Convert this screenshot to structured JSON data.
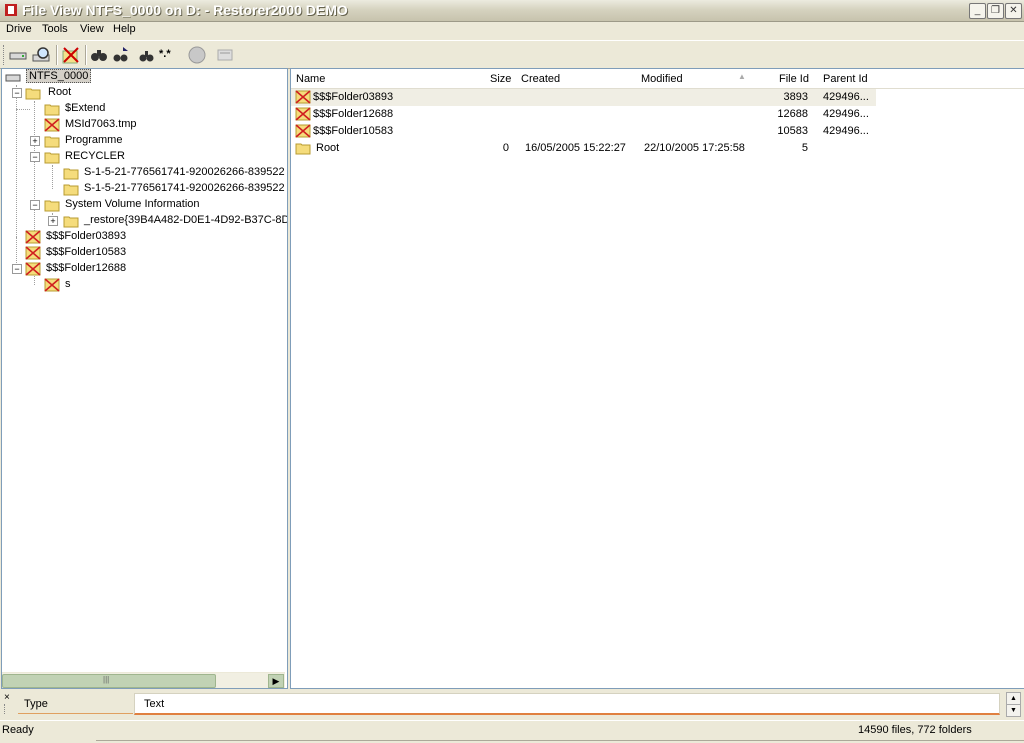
{
  "window": {
    "title": "File View NTFS_0000 on D: - Restorer2000 DEMO",
    "minimize": "_",
    "restore": "❐",
    "close": "✕"
  },
  "menu": [
    "Drive",
    "Tools",
    "View",
    "Help"
  ],
  "toolbar": {
    "buttons": [
      "drive-icon",
      "search-icon",
      "recover-icon",
      "find-icon",
      "find-next-icon",
      "mask-icon",
      "stop-icon",
      "options-icon"
    ],
    "mask_label": "*.*",
    "stop_label": "Stop"
  },
  "tree": {
    "root_label": "NTFS_0000",
    "expanders": {
      "minus": "−",
      "plus": "+"
    },
    "items": [
      {
        "label": "Root"
      },
      {
        "label": "$Extend"
      },
      {
        "label": "MSId7063.tmp"
      },
      {
        "label": "Programme"
      },
      {
        "label": "RECYCLER"
      },
      {
        "label": "S-1-5-21-776561741-920026266-839522"
      },
      {
        "label": "S-1-5-21-776561741-920026266-839522"
      },
      {
        "label": "System Volume Information"
      },
      {
        "label": "_restore{39B4A482-D0E1-4D92-B37C-8D"
      },
      {
        "label": "$$$Folder03893"
      },
      {
        "label": "$$$Folder10583"
      },
      {
        "label": "$$$Folder12688"
      },
      {
        "label": "s"
      }
    ],
    "scroll_grip": "|||",
    "scroll_arrow": "▶"
  },
  "list": {
    "columns": [
      "Name",
      "Size",
      "Created",
      "Modified",
      "File Id",
      "Parent Id"
    ],
    "sort_indicator": "▲",
    "rows": [
      {
        "name": "$$$Folder03893",
        "size": "",
        "created": "",
        "modified": "",
        "file_id": "3893",
        "parent_id": "429496..."
      },
      {
        "name": "$$$Folder12688",
        "size": "",
        "created": "",
        "modified": "",
        "file_id": "12688",
        "parent_id": "429496..."
      },
      {
        "name": "$$$Folder10583",
        "size": "",
        "created": "",
        "modified": "",
        "file_id": "10583",
        "parent_id": "429496..."
      },
      {
        "name": "Root",
        "size": "0",
        "created": "16/05/2005 15:22:27",
        "modified": "22/10/2005 17:25:58",
        "file_id": "5",
        "parent_id": ""
      }
    ]
  },
  "bottom_panel": {
    "close": "×",
    "tab_type": "Type",
    "tab_text": "Text",
    "scroll_up": "▲",
    "scroll_down": "▼"
  },
  "status": {
    "left": "Ready",
    "right": "14590 files, 772 folders"
  }
}
